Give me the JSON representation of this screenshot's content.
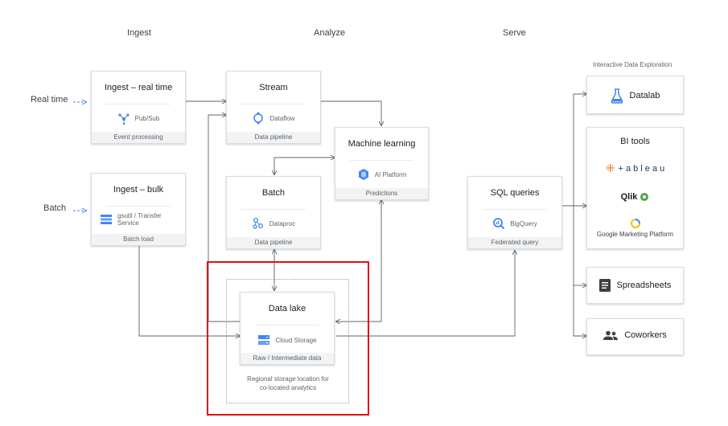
{
  "columns": {
    "ingest": "Ingest",
    "analyze": "Analyze",
    "serve": "Serve"
  },
  "inputs": {
    "realtime": "Real time",
    "batch": "Batch"
  },
  "boxes": {
    "ingest_rt": {
      "title": "Ingest – real time",
      "service": "Pub/Sub",
      "footer": "Event processing",
      "icon": "pubsub-icon"
    },
    "ingest_bulk": {
      "title": "Ingest – bulk",
      "service": "gsutil / Transfer\nService",
      "footer": "Batch load",
      "icon": "transfer-service-icon"
    },
    "stream": {
      "title": "Stream",
      "service": "Dataflow",
      "footer": "Data pipeline",
      "icon": "dataflow-icon"
    },
    "batch": {
      "title": "Batch",
      "service": "Dataproc",
      "footer": "Data pipeline",
      "icon": "dataproc-icon"
    },
    "ml": {
      "title": "Machine learning",
      "service": "AI Platform",
      "footer": "Predictions",
      "icon": "ai-platform-icon"
    },
    "sql": {
      "title": "SQL queries",
      "service": "BigQuery",
      "footer": "Federated query",
      "icon": "bigquery-icon"
    },
    "datalake": {
      "title": "Data lake",
      "service": "Cloud Storage",
      "footer": "Raw / Intermediate data",
      "icon": "cloud-storage-icon"
    }
  },
  "datalake_note": "Regional storage location for\nco-located analytics",
  "serve": {
    "section_label": "Interactive Data Exploration",
    "datalab": "Datalab",
    "bi_tools": "BI tools",
    "tableau": "+ a b l e a u",
    "qlik": "Qlik",
    "gmp": "Google Marketing Platform",
    "spreadsheets": "Spreadsheets",
    "coworkers": "Coworkers"
  },
  "colors": {
    "arrow": "#5f6368",
    "input_arrow": "#4285f4",
    "highlight": "#e01010"
  }
}
